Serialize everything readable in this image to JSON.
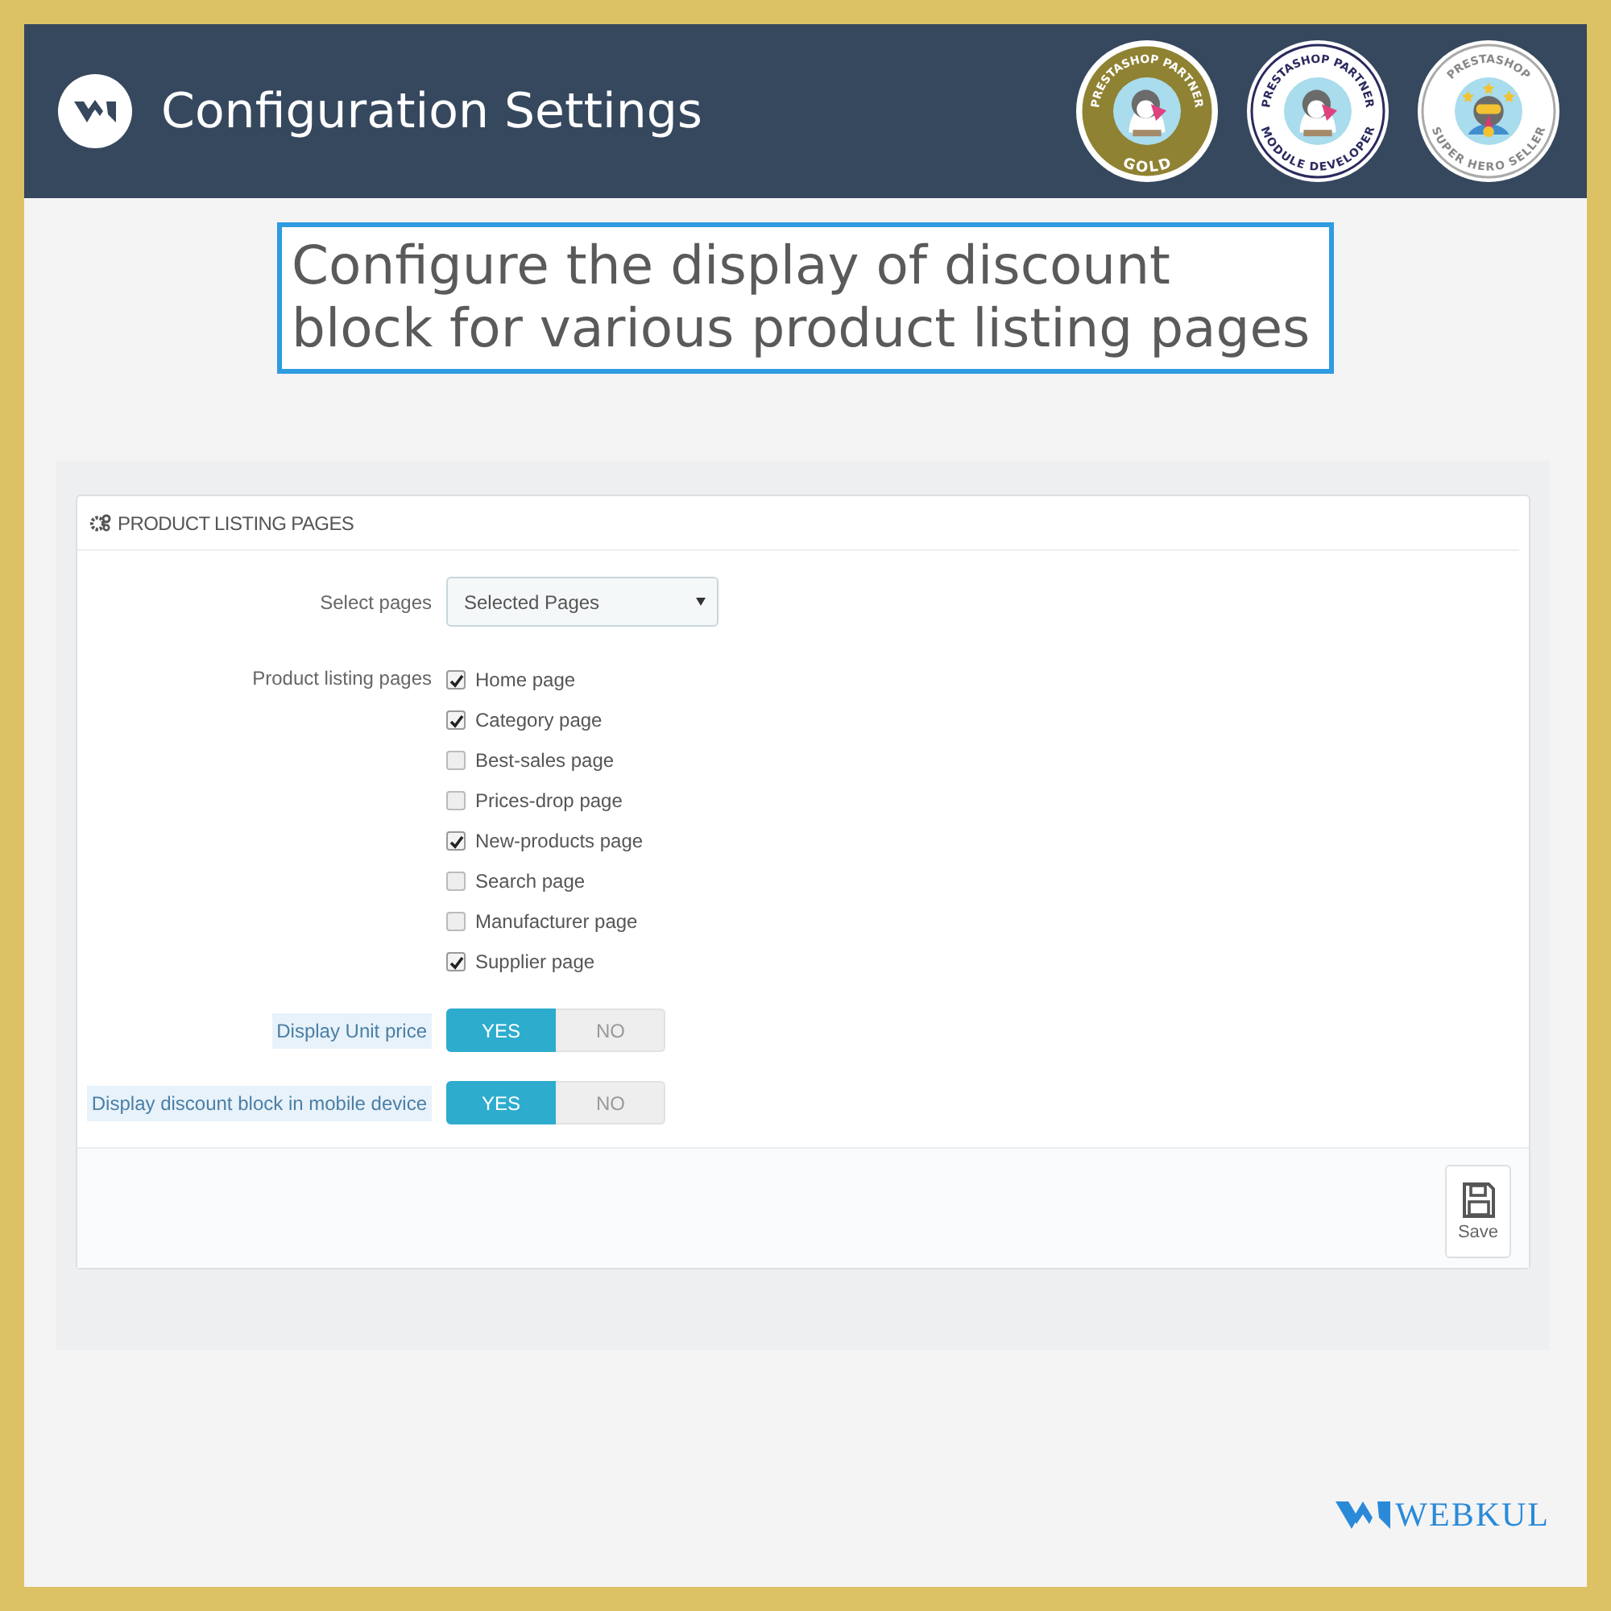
{
  "header": {
    "title": "Configuration Settings",
    "badges": [
      {
        "kind": "gold",
        "top": "PRESTASHOP PARTNER",
        "bottom": "GOLD"
      },
      {
        "kind": "developer",
        "top": "PRESTASHOP PARTNER",
        "bottom": "MODULE DEVELOPER"
      },
      {
        "kind": "hero",
        "top": "PRESTASHOP",
        "bottom": "SUPER HERO SELLER"
      }
    ]
  },
  "headline": "Configure the display of discount block for various product listing pages",
  "panel": {
    "title": "PRODUCT LISTING PAGES",
    "select": {
      "label": "Select pages",
      "value": "Selected Pages"
    },
    "pages": {
      "label": "Product listing pages",
      "options": [
        {
          "label": "Home page",
          "checked": true
        },
        {
          "label": "Category page",
          "checked": true
        },
        {
          "label": "Best-sales page",
          "checked": false
        },
        {
          "label": "Prices-drop page",
          "checked": false
        },
        {
          "label": "New-products page",
          "checked": true
        },
        {
          "label": "Search page",
          "checked": false
        },
        {
          "label": "Manufacturer page",
          "checked": false
        },
        {
          "label": "Supplier page",
          "checked": true
        }
      ]
    },
    "switches": [
      {
        "label": "Display Unit price",
        "yes": "YES",
        "no": "NO",
        "on": true
      },
      {
        "label": "Display discount block in mobile device",
        "yes": "YES",
        "no": "NO",
        "on": true
      }
    ],
    "save": "Save"
  },
  "brand": "WEBKUL"
}
